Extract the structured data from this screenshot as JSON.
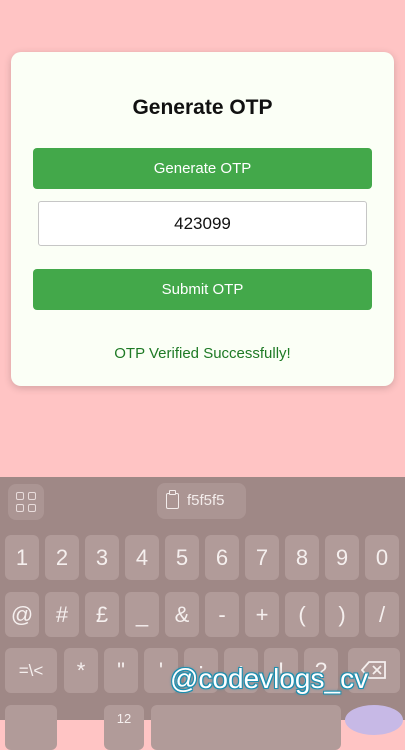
{
  "card": {
    "title": "Generate OTP",
    "generate_button": "Generate OTP",
    "otp_value": "423099",
    "submit_button": "Submit OTP",
    "status_message": "OTP Verified Successfully!"
  },
  "keyboard": {
    "clipboard_chip": "f5f5f5",
    "row1": [
      "1",
      "2",
      "3",
      "4",
      "5",
      "6",
      "7",
      "8",
      "9",
      "0"
    ],
    "row2": [
      "@",
      "#",
      "£",
      "_",
      "&",
      "-",
      "+",
      "(",
      ")",
      "/"
    ],
    "row3": [
      "=\\<",
      "*",
      "\"",
      "'",
      ":",
      ";",
      "!",
      "?",
      ""
    ],
    "row4": [
      "",
      "12",
      ""
    ]
  },
  "watermark": "@codevlogs_cv",
  "colors": {
    "page_background": "#ffc4c4",
    "card_background": "#fbfff6",
    "button_green": "#43a84a",
    "status_green": "#1e7a25",
    "keyboard_background": "#9f8886"
  }
}
